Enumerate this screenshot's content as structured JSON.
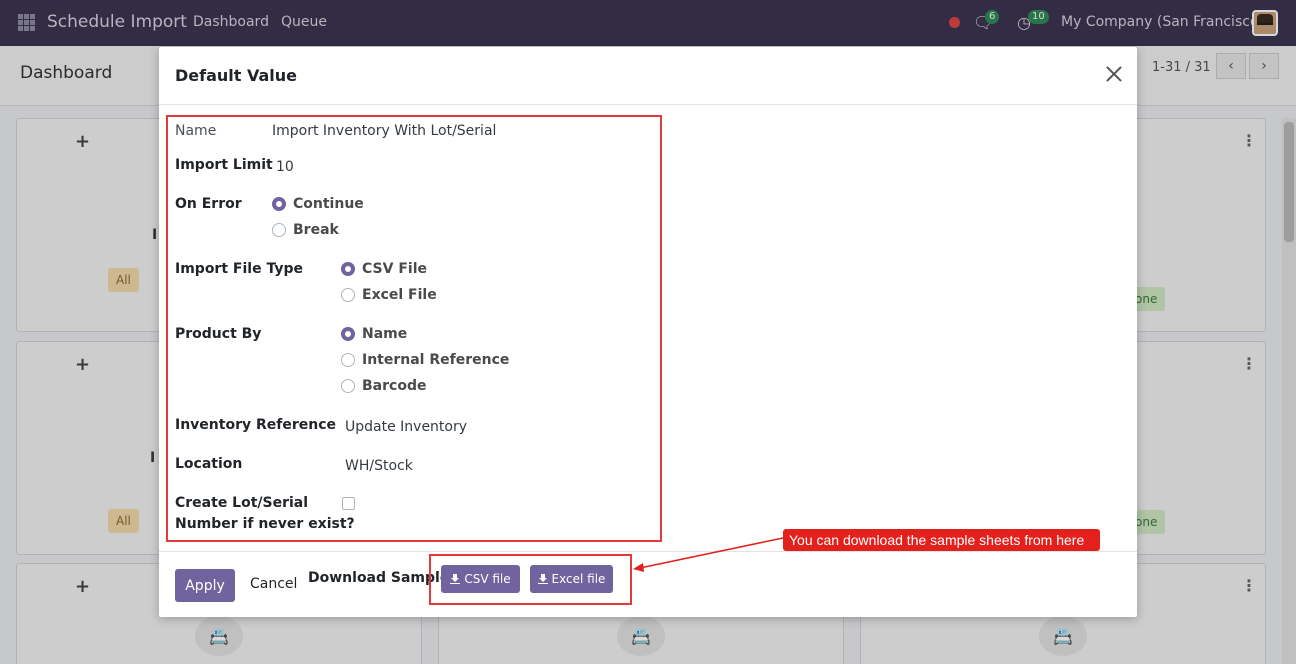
{
  "navbar": {
    "app_name": "Schedule Import",
    "links": [
      "Dashboard",
      "Queue"
    ],
    "messages_count": "6",
    "activities_count": "10",
    "company": "My Company (San Francisco)"
  },
  "control_panel": {
    "title": "Dashboard",
    "pager": "1-31 / 31",
    "prev_icon": "chevron-left-icon",
    "next_icon": "chevron-right-icon"
  },
  "background_cards": {
    "tag_all": "All",
    "tag_done_fragment": "one",
    "plus": "+",
    "title_fragment": "I"
  },
  "dialog": {
    "title": "Default Value",
    "fields": {
      "name_label": "Name",
      "name_value": "Import Inventory With Lot/Serial",
      "import_limit_label": "Import Limit",
      "import_limit_value": "10",
      "on_error_label": "On Error",
      "on_error_options": [
        "Continue",
        "Break"
      ],
      "on_error_selected": "Continue",
      "file_type_label": "Import File Type",
      "file_type_options": [
        "CSV File",
        "Excel File"
      ],
      "file_type_selected": "CSV File",
      "product_by_label": "Product By",
      "product_by_options": [
        "Name",
        "Internal Reference",
        "Barcode"
      ],
      "product_by_selected": "Name",
      "inventory_ref_label": "Inventory Reference",
      "inventory_ref_value": "Update Inventory",
      "location_label": "Location",
      "location_value": "WH/Stock",
      "create_lot_label_line1": "Create Lot/Serial",
      "create_lot_label_line2": "Number if never exist?",
      "create_lot_checked": false
    },
    "footer": {
      "apply": "Apply",
      "cancel": "Cancel",
      "download_label": "Download Samples:",
      "csv_button": "CSV file",
      "excel_button": "Excel file"
    }
  },
  "callout": {
    "text": "You can download the sample sheets from here",
    "color": "#e3201b"
  },
  "colors": {
    "navbar": "#3b3451",
    "primary": "#71639e",
    "highlight": "#e23b3b"
  }
}
